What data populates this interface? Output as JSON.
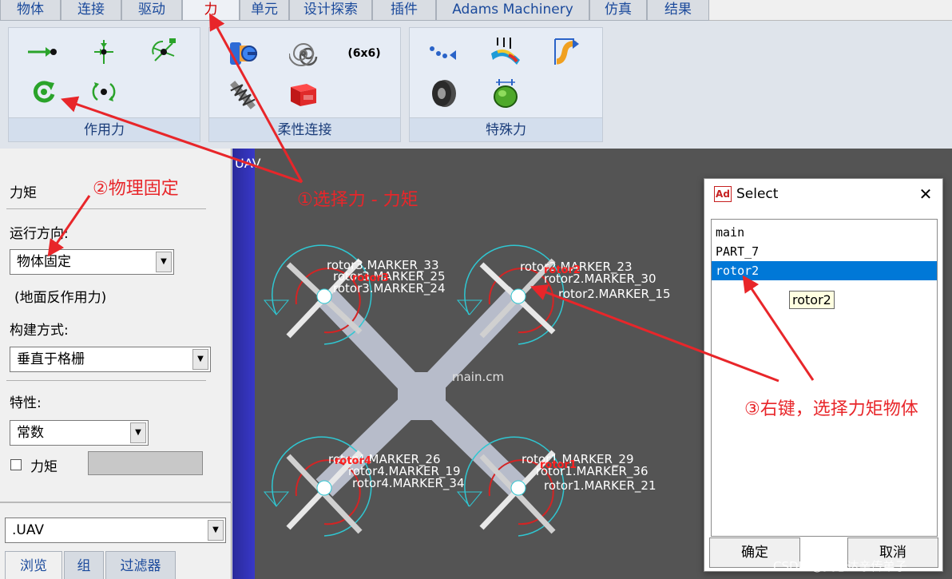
{
  "tabs": [
    "物体",
    "连接",
    "驱动",
    "力",
    "单元",
    "设计探索",
    "插件",
    "Adams Machinery",
    "仿真",
    "结果"
  ],
  "active_tab": "力",
  "ribbon": {
    "groups": [
      {
        "label": "作用力",
        "icons": [
          "single-component-force-icon",
          "multi-component-force-icon",
          "general-force-icon",
          "torque-icon",
          "rotational-torque-icon"
        ]
      },
      {
        "label": "柔性连接",
        "icons": [
          "bushing-icon",
          "torsion-spring-icon",
          "field-6x6-icon",
          "spring-damper-icon",
          "beam-icon"
        ]
      },
      {
        "label": "特殊力",
        "icons": [
          "particle-force-icon",
          "modal-force-icon",
          "friction-icon",
          "tire-icon",
          "contact-icon"
        ]
      }
    ],
    "field_label": "(6x6)"
  },
  "left_panel": {
    "title": "力矩",
    "direction_label": "运行方向:",
    "direction_value": "物体固定",
    "reaction_note": "(地面反作用力)",
    "construction_label": "构建方式:",
    "construction_value": "垂直于格栅",
    "property_label": "特性:",
    "property_value": "常数",
    "torque_checkbox_label": "力矩",
    "model_value": ".UAV",
    "bottom_tabs": [
      "浏览",
      "组",
      "过滤器"
    ]
  },
  "viewport": {
    "model_name": "UAV",
    "center_label": "main.cm",
    "marker_labels": [
      "rotor3.MARKER_33",
      "rotor3.MARKER_25",
      "rotor3.MARKER_24",
      "rotor2.MARKER_23",
      "rotor2.MARKER_30",
      "rotor2.MARKER_15",
      "rotor4.MARKER_26",
      "rotor4.MARKER_19",
      "rotor4.MARKER_34",
      "rotor1.MARKER_29",
      "rotor1.MARKER_36",
      "rotor1.MARKER_21"
    ],
    "red_labels": [
      "rotor3",
      "rotor2",
      "rotor4",
      "rotor1"
    ]
  },
  "dialog": {
    "icon_text": "Ad",
    "title": "Select",
    "close": "✕",
    "items": [
      "main",
      "PART_7",
      "rotor2"
    ],
    "selected": "rotor2",
    "tooltip": "rotor2",
    "ok": "确定",
    "cancel": "取消"
  },
  "annotations": {
    "step1": "①选择力 - 力矩",
    "step2": "②物理固定",
    "step3": "③右键，选择力矩物体",
    "color": "#e8262a"
  },
  "watermark": "CSDN @吴恩达亲传弟子"
}
